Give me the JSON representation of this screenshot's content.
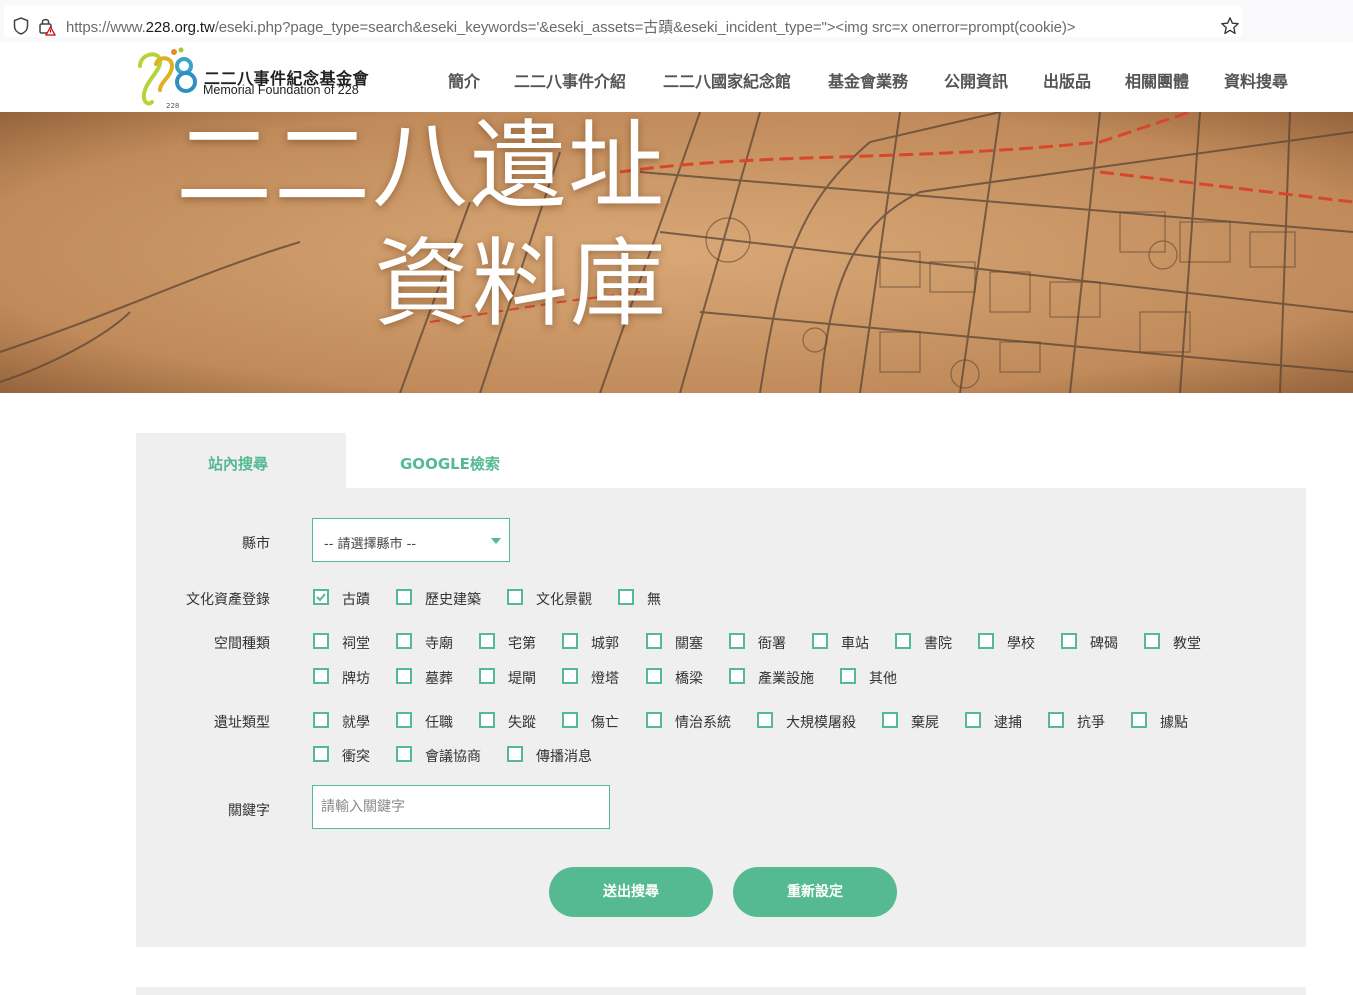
{
  "browser": {
    "url_prefix": "https://www.",
    "url_domain": "228.org.tw",
    "url_rest": "/eseki.php?page_type=search&eseki_keywords='&eseki_assets=古蹟&eseki_incident_type=\"><img src=x onerror=prompt(cookie)>"
  },
  "header": {
    "logo_number": "228",
    "org_name_cn": "二二八事件紀念基金會",
    "org_name_en": "Memorial Foundation of 228",
    "nav": [
      "簡介",
      "二二八事件介紹",
      "二二八國家紀念館",
      "基金會業務",
      "公開資訊",
      "出版品",
      "相關團體",
      "資料搜尋"
    ]
  },
  "banner": {
    "title_line1": "二二八遺址",
    "title_line2": "資料庫"
  },
  "tabs": [
    "站內搜尋",
    "GOOGLE檢索"
  ],
  "form": {
    "city_label": "縣市",
    "city_selected": "-- 請選擇縣市 --",
    "assets_label": "文化資產登錄",
    "assets": [
      {
        "label": "古蹟",
        "checked": true
      },
      {
        "label": "歷史建築",
        "checked": false
      },
      {
        "label": "文化景觀",
        "checked": false
      },
      {
        "label": "無",
        "checked": false
      }
    ],
    "space_label": "空間種類",
    "space": [
      "祠堂",
      "寺廟",
      "宅第",
      "城郭",
      "關塞",
      "衙署",
      "車站",
      "書院",
      "學校",
      "碑碣",
      "教堂",
      "牌坊",
      "墓葬",
      "堤閘",
      "燈塔",
      "橋梁",
      "產業設施",
      "其他"
    ],
    "site_label": "遺址類型",
    "site": [
      "就學",
      "任職",
      "失蹤",
      "傷亡",
      "情治系統",
      "大規模屠殺",
      "棄屍",
      "逮捕",
      "抗爭",
      "據點",
      "衝突",
      "會議協商",
      "傳播消息"
    ],
    "keyword_label": "關鍵字",
    "keyword_placeholder": "請輸入關鍵字",
    "keyword_value": "",
    "submit_label": "送出搜尋",
    "reset_label": "重新設定"
  },
  "colors": {
    "accent": "#55b991",
    "panel_bg": "#efefef",
    "banner_bg": "#c89668"
  }
}
